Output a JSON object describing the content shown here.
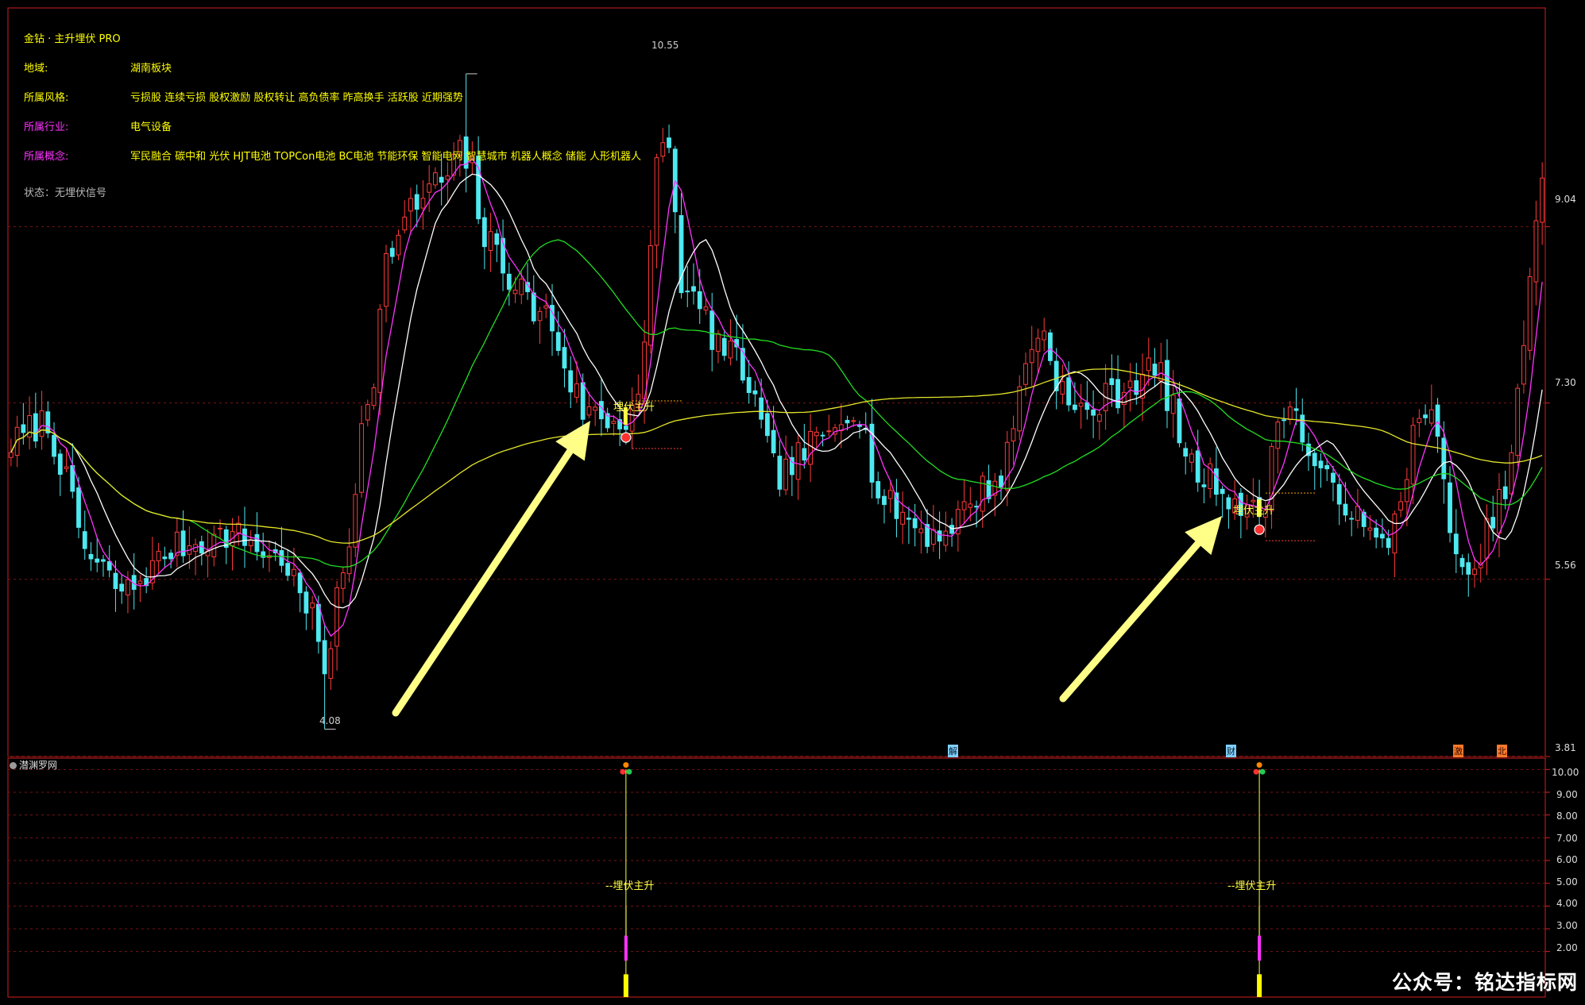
{
  "app": {
    "indicator_title": "金钻 · 主升埋伏 PRO",
    "status": "状态：无埋伏信号",
    "sub_panel_title": "潜渊罗网",
    "watermark": "公众号：铭达指标网"
  },
  "info": [
    {
      "label": "地域:",
      "value": "湖南板块",
      "color": "#ffff00"
    },
    {
      "label": "所属风格:",
      "value": "亏损股 连续亏损 股权激励 股权转让 高负债率 昨高换手 活跃股 近期强势",
      "color": "#ffff00"
    },
    {
      "label": "所属行业:",
      "value": "电气设备",
      "color": "#ff33ff"
    },
    {
      "label": "所属概念:",
      "value": "军民融合 碳中和 光伏 HJT电池 TOPCon电池 BC电池 节能环保 智能电网 智慧城市 机器人概念 储能 人形机器人",
      "color": "#ff33ff"
    }
  ],
  "colors": {
    "background": "#000000",
    "up": "#ff3a3a",
    "down": "#4ee8f0",
    "ma_white": "#ffffff",
    "ma_magenta": "#ff33ff",
    "ma_green": "#22dd22",
    "ma_yellow": "#e6e62a",
    "frame": "#d22020",
    "signal": "#ffff44"
  },
  "price_axis": {
    "min": 3.81,
    "max": 11.2,
    "ticks": [
      "9.04",
      "7.30",
      "5.56",
      "3.81"
    ]
  },
  "price_labels": {
    "high": "10.55",
    "low": "4.08"
  },
  "signals": [
    {
      "label": "埋伏主升",
      "bar": 100,
      "price": 6.96
    },
    {
      "label": "埋伏主升",
      "bar": 203,
      "price": 6.05
    }
  ],
  "event_markers": [
    "解",
    "财",
    "激",
    "北"
  ],
  "sub_axis": {
    "min": 0,
    "max": 10.5,
    "ticks": [
      "10.00",
      "9.00",
      "8.00",
      "7.00",
      "6.00",
      "5.00",
      "4.00",
      "3.00",
      "2.00"
    ]
  },
  "sub_signals": [
    {
      "label": "--埋伏主升",
      "bar": 100
    },
    {
      "label": "--埋伏主升",
      "bar": 203
    }
  ],
  "chart_data": {
    "type": "candlestick",
    "bars": 250,
    "anchors": [
      [
        0,
        6.9
      ],
      [
        5,
        7.1
      ],
      [
        14,
        5.7
      ],
      [
        18,
        5.45
      ],
      [
        28,
        5.9
      ],
      [
        36,
        6.0
      ],
      [
        44,
        5.75
      ],
      [
        49,
        5.2
      ],
      [
        51,
        4.7
      ],
      [
        54,
        5.6
      ],
      [
        58,
        7.4
      ],
      [
        62,
        8.9
      ],
      [
        68,
        9.4
      ],
      [
        74,
        9.7
      ],
      [
        78,
        8.8
      ],
      [
        86,
        8.2
      ],
      [
        94,
        7.2
      ],
      [
        99,
        7.1
      ],
      [
        102,
        7.4
      ],
      [
        106,
        10.0
      ],
      [
        110,
        8.3
      ],
      [
        118,
        7.7
      ],
      [
        125,
        6.6
      ],
      [
        131,
        6.9
      ],
      [
        137,
        7.3
      ],
      [
        142,
        6.3
      ],
      [
        150,
        6.0
      ],
      [
        160,
        6.5
      ],
      [
        167,
        8.0
      ],
      [
        173,
        7.2
      ],
      [
        186,
        7.6
      ],
      [
        193,
        6.6
      ],
      [
        203,
        6.2
      ],
      [
        207,
        7.3
      ],
      [
        214,
        6.5
      ],
      [
        223,
        5.9
      ],
      [
        230,
        7.2
      ],
      [
        237,
        5.5
      ],
      [
        242,
        6.3
      ],
      [
        250,
        9.5
      ]
    ],
    "volatility": 0.17,
    "seed": 7
  }
}
